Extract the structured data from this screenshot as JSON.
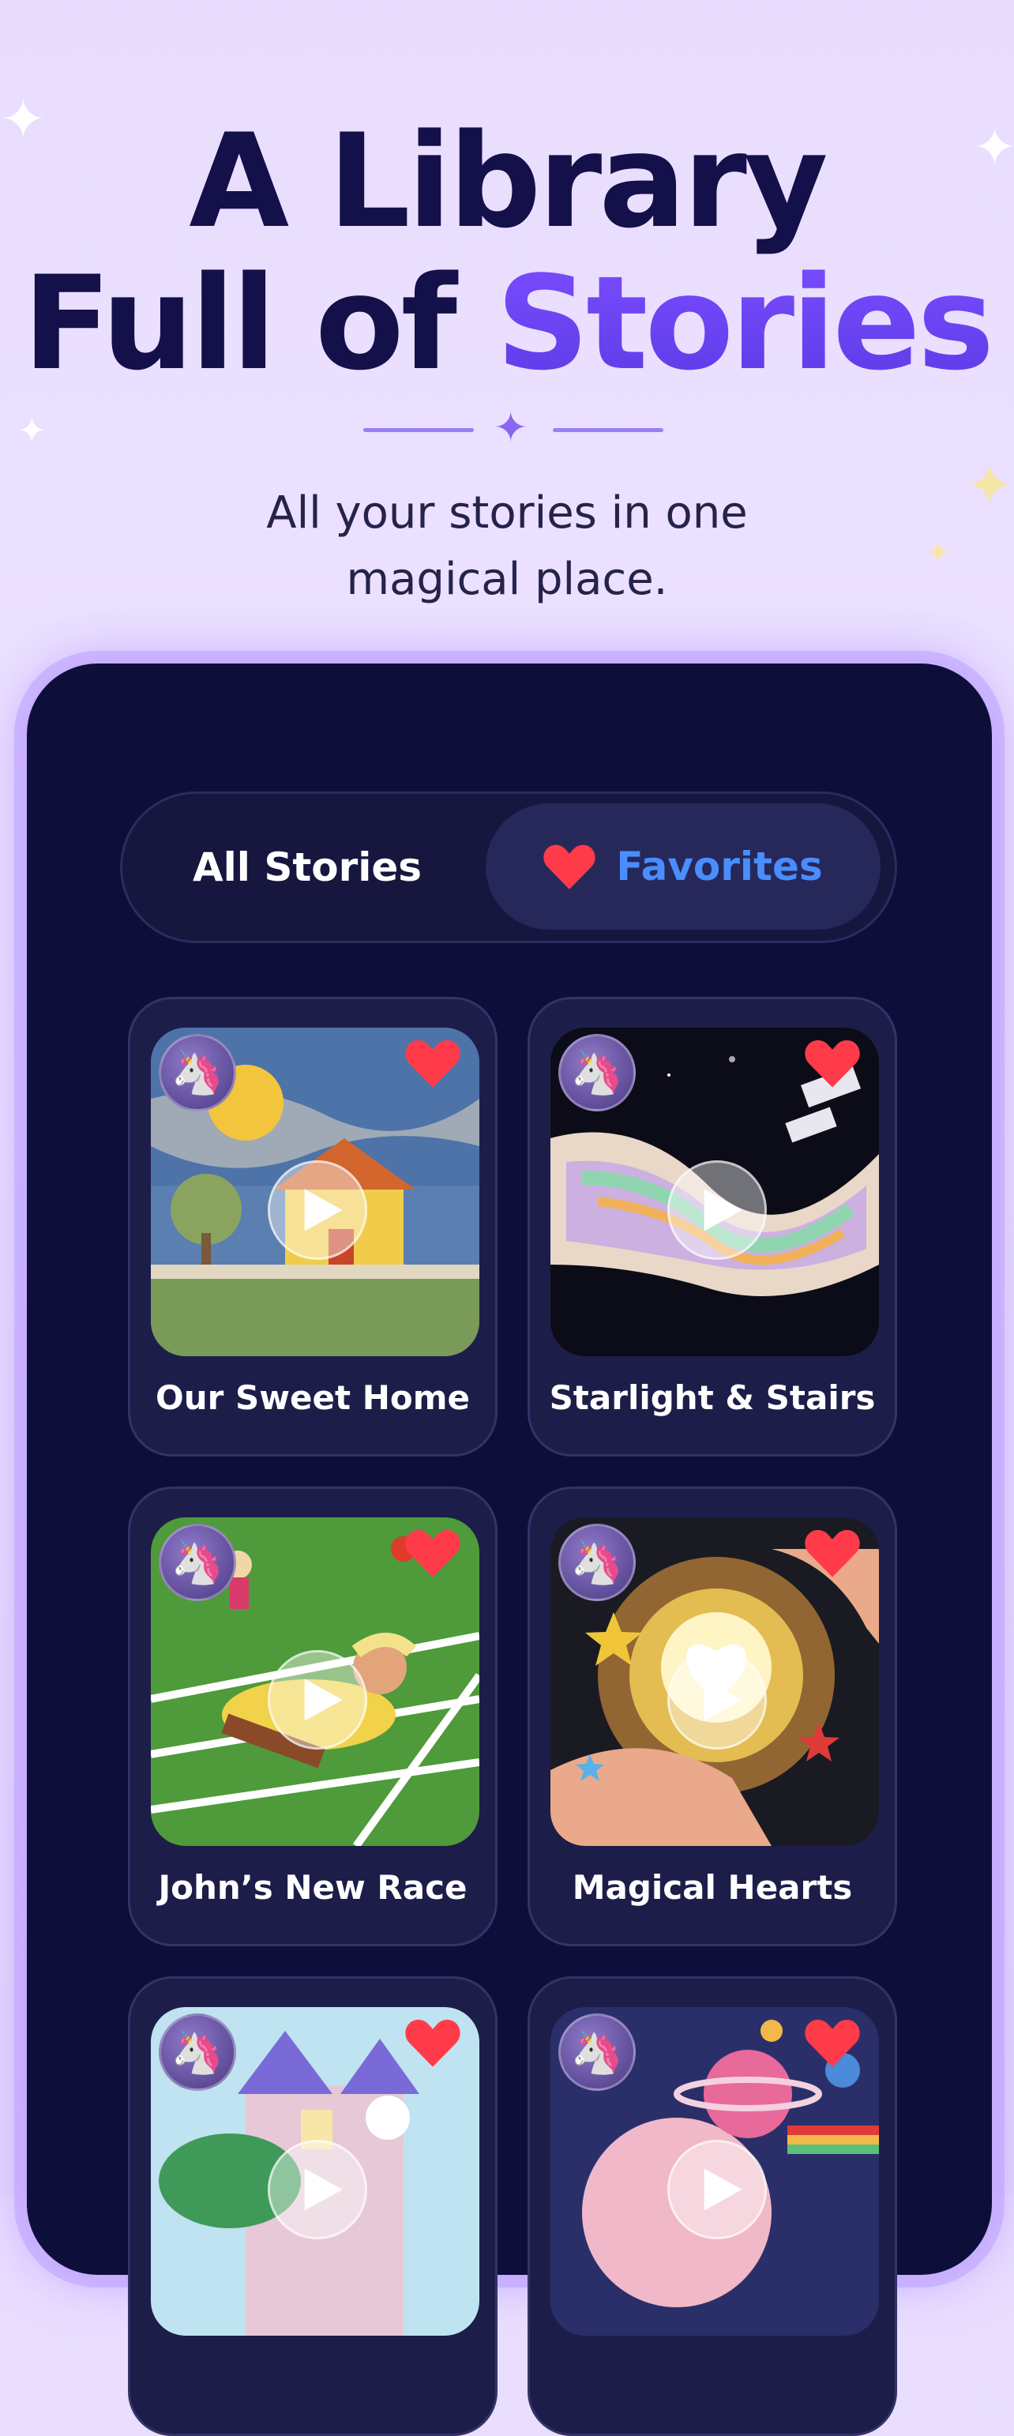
{
  "header": {
    "title_line1": "A Library",
    "title_line2_plain": "Full of ",
    "title_line2_accent": "Stories",
    "subtitle_line1": "All your stories in one",
    "subtitle_line2": "magical place."
  },
  "tabs": {
    "all_label": "All Stories",
    "favorites_label": "Favorites",
    "selected": "Favorites"
  },
  "stories": [
    {
      "title": "Our Sweet Home",
      "badge_icon": "unicorn-icon",
      "favorite": true
    },
    {
      "title": "Starlight & Stairs",
      "badge_icon": "unicorn-icon",
      "favorite": true
    },
    {
      "title": "John’s New Race",
      "badge_icon": "unicorn-icon",
      "favorite": true
    },
    {
      "title": "Magical Hearts",
      "badge_icon": "unicorn-icon",
      "favorite": true
    },
    {
      "title": "",
      "badge_icon": "unicorn-icon",
      "favorite": true
    },
    {
      "title": "",
      "badge_icon": "unicorn-icon",
      "favorite": true
    }
  ],
  "colors": {
    "background": "#e9ddff",
    "title": "#14104a",
    "accent": "#6a3ff0",
    "phone_bg": "#0e0e3a",
    "card_bg": "#1d1d4a",
    "favorites_text": "#4a8dff",
    "heart": "#ff3b4a"
  }
}
